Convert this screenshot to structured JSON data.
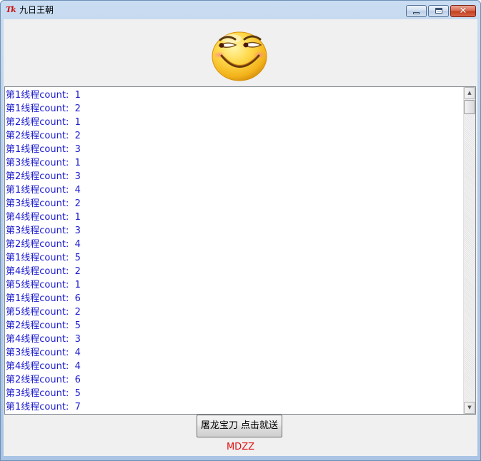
{
  "window": {
    "title": "九日王朝",
    "app_icon_text": "Tk",
    "close_glyph": "✕"
  },
  "colors": {
    "log_text": "#1c1ccf",
    "status_text": "#e01010",
    "client_bg": "#f0f0f0"
  },
  "icons": [
    "tk-app-icon",
    "minimize-icon",
    "maximize-icon",
    "close-icon",
    "smiley-emoji-icon",
    "scroll-up-arrow-icon",
    "scroll-down-arrow-icon"
  ],
  "log": {
    "lines": [
      "第1线程count:  1",
      "第1线程count:  2",
      "第2线程count:  1",
      "第2线程count:  2",
      "第1线程count:  3",
      "第3线程count:  1",
      "第2线程count:  3",
      "第1线程count:  4",
      "第3线程count:  2",
      "第4线程count:  1",
      "第3线程count:  3",
      "第2线程count:  4",
      "第1线程count:  5",
      "第4线程count:  2",
      "第5线程count:  1",
      "第1线程count:  6",
      "第5线程count:  2",
      "第2线程count:  5",
      "第4线程count:  3",
      "第3线程count:  4",
      "第4线程count:  4",
      "第2线程count:  6",
      "第3线程count:  5",
      "第1线程count:  7"
    ]
  },
  "button": {
    "label": "屠龙宝刀 点击就送"
  },
  "status": {
    "text": "MDZZ"
  }
}
